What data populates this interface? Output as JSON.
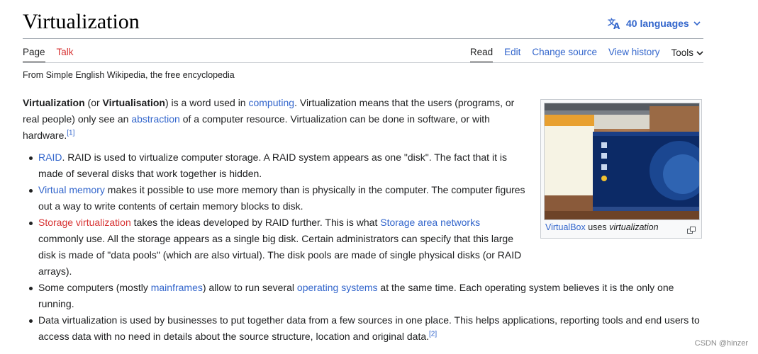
{
  "page": {
    "title": "Virtualization",
    "languages_label": "40 languages",
    "tagline": "From Simple English Wikipedia, the free encyclopedia"
  },
  "tabs": {
    "left": [
      {
        "label": "Page"
      },
      {
        "label": "Talk"
      }
    ],
    "right": [
      {
        "label": "Read"
      },
      {
        "label": "Edit"
      },
      {
        "label": "Change source"
      },
      {
        "label": "View history"
      },
      {
        "label": "Tools"
      }
    ]
  },
  "intro": {
    "term1": "Virtualization",
    "t1": " (or ",
    "term2": "Virtualisation",
    "t2": ") is a word used in ",
    "link_computing": "computing",
    "t3": ". Virtualization means that the users (programs, or real people) only see an ",
    "link_abstraction": "abstraction",
    "t4": " of a computer resource. Virtualization can be done in software, or with hardware.",
    "ref1": "[1]"
  },
  "bullets": {
    "raid": {
      "link": "RAID",
      "text": ". RAID is used to virtualize computer storage. A RAID system appears as one \"disk\". The fact that it is made of several disks that work together is hidden."
    },
    "vm": {
      "link": "Virtual memory",
      "text": " makes it possible to use more memory than is physically in the computer. The computer figures out a way to write contents of certain memory blocks to disk."
    },
    "storage": {
      "link": "Storage virtualization",
      "text1": " takes the ideas developed by RAID further. This is what ",
      "link2": "Storage area networks",
      "text2": " commonly use. All the storage appears as a single big disk. Certain administrators can specify that this large disk is made of \"data pools\" (which are also virtual). The disk pools are made of single physical disks (or RAID arrays)."
    },
    "mainframes": {
      "text1": "Some computers (mostly ",
      "link": "mainframes",
      "text2": ") allow to run several ",
      "link2": "operating systems",
      "text3": " at the same time. Each operating system believes it is the only one running."
    },
    "data": {
      "text": "Data virtualization is used by businesses to put together data from a few sources in one place. This helps applications, reporting tools and end users to access data with no need in details about the source structure, location and original data.",
      "ref": "[2]"
    }
  },
  "thumbnail": {
    "caption_link": "VirtualBox",
    "caption_text": " uses ",
    "caption_italic": "virtualization"
  },
  "watermark": "CSDN @hinzer"
}
